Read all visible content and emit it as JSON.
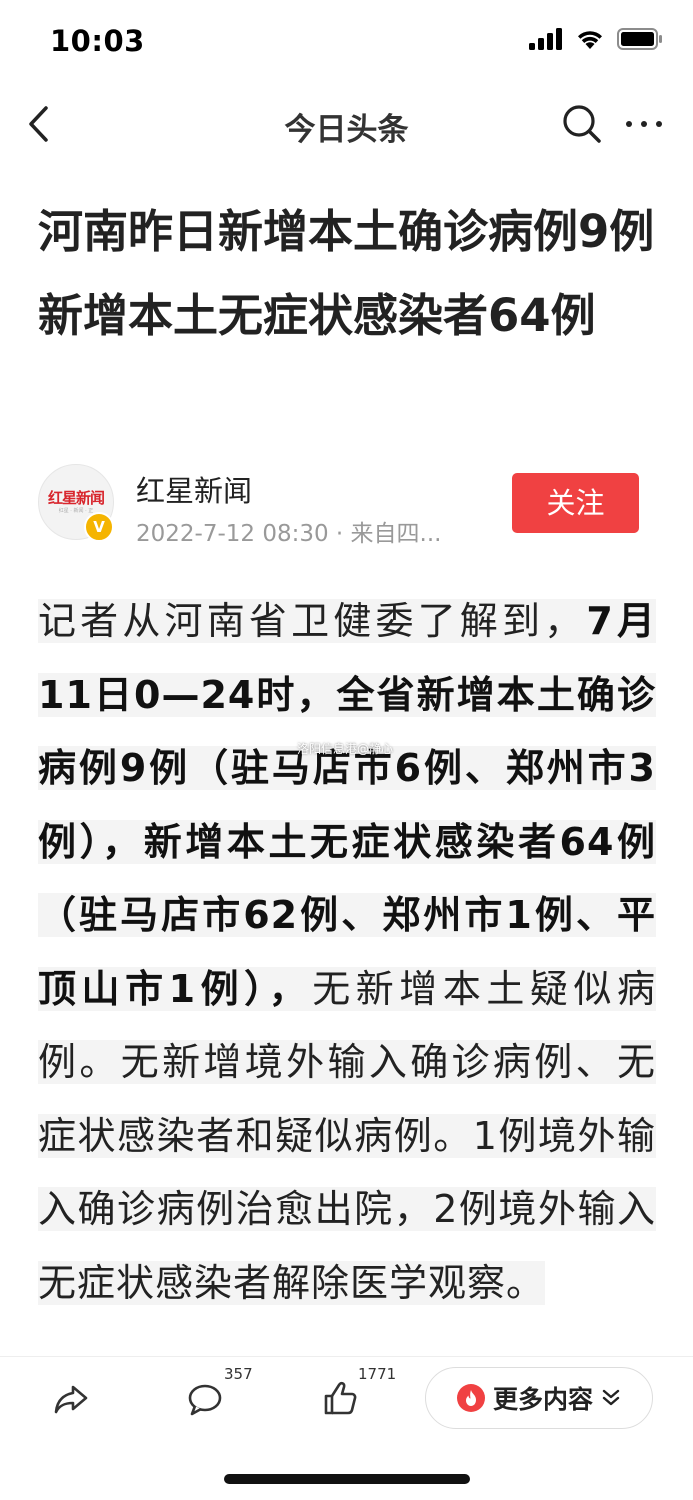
{
  "status_bar": {
    "time": "10:03"
  },
  "nav": {
    "title": "今日头条"
  },
  "article": {
    "title": "河南昨日新增本土确诊病例9例 新增本土无症状感染者64例",
    "author": {
      "name": "红星新闻",
      "meta": "2022-7-12 08:30 · 来自四...",
      "avatar_text": "红星新闻",
      "avatar_sub": "红星 · 新闻 · 正"
    },
    "follow_label": "关注",
    "body_parts": [
      "记者从河南省卫健委了解到，",
      "7月11日0—24时，全省新增本土确诊病例9例（驻马店市6例、郑州市3例），新增本土无症状感染者64例（驻马店市62例、郑州市1例、平顶山市1例），",
      "无新增本土疑似病例。无新增境外输入确诊病例、无症状感染者和疑似病例。1例境外输入确诊病例治愈出院，2例境外输入无症状感染者解除医学观察。"
    ],
    "watermark": "洛阳信息港@静心"
  },
  "bottom_bar": {
    "comment_count": "357",
    "like_count": "1771",
    "more_label": "更多内容"
  }
}
